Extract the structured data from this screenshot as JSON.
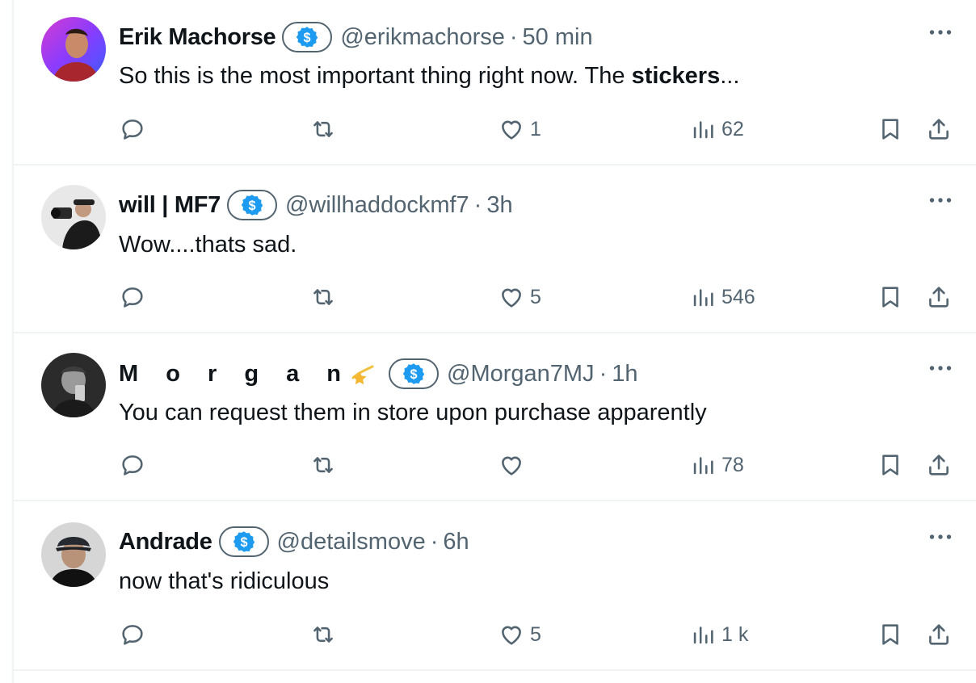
{
  "tweets": [
    {
      "name": "Erik Machorse",
      "handle": "@erikmachorse",
      "separator": "·",
      "time": "50 min",
      "text_plain": "So this is the most important thing right now. The ",
      "text_bold": "stickers",
      "text_after": "...",
      "likes": "1",
      "views": "62"
    },
    {
      "name": "will | MF7",
      "handle": "@willhaddockmf7",
      "separator": "·",
      "time": "3h",
      "text_plain": "Wow....thats sad.",
      "likes": "5",
      "views": "546"
    },
    {
      "name": "M o r g a n",
      "name_emoji": "shooting-star-emoji",
      "handle": "@Morgan7MJ",
      "separator": "·",
      "time": "1h",
      "text_plain": "You can request them in store upon purchase apparently",
      "likes": "",
      "views": "78"
    },
    {
      "name": "Andrade",
      "handle": "@detailsmove",
      "separator": "·",
      "time": "6h",
      "text_plain": "now that's ridiculous",
      "likes": "5",
      "views": "1 k"
    }
  ],
  "icons": {
    "reply": "reply-icon",
    "retweet": "retweet-icon",
    "like": "heart-icon",
    "views": "views-chart-icon",
    "bookmark": "bookmark-icon",
    "share": "share-icon",
    "more": "more-dots-icon",
    "badge": "verified-dollar-badge-icon"
  },
  "colors": {
    "badge_blue": "#1d9bf0",
    "muted": "#536471",
    "divider": "#eff3f4"
  }
}
